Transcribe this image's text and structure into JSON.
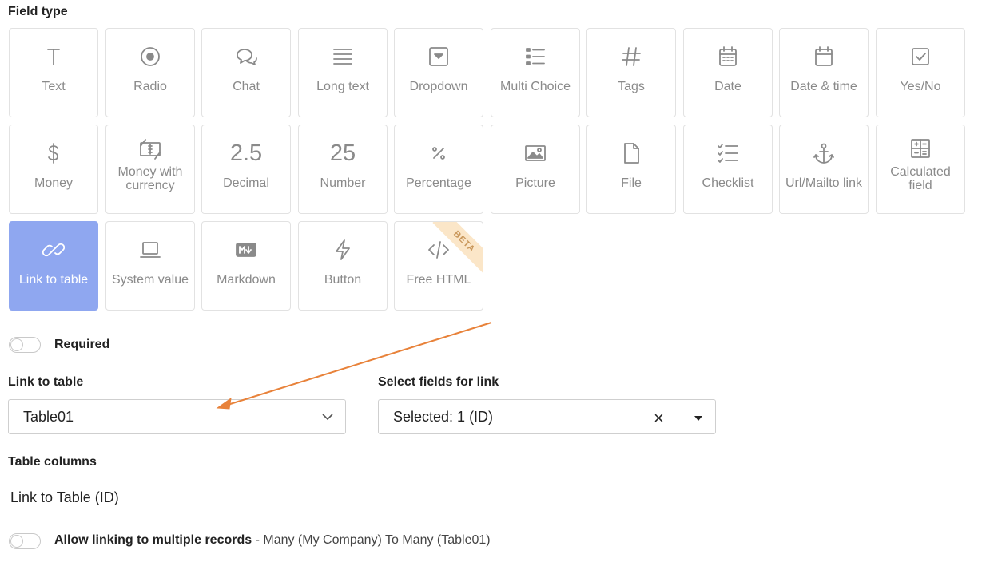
{
  "field_type": {
    "title": "Field type",
    "tiles": [
      {
        "label": "Text",
        "icon": "text-icon"
      },
      {
        "label": "Radio",
        "icon": "radio-icon"
      },
      {
        "label": "Chat",
        "icon": "chat-icon"
      },
      {
        "label": "Long text",
        "icon": "long-text-icon"
      },
      {
        "label": "Dropdown",
        "icon": "dropdown-icon"
      },
      {
        "label": "Multi Choice",
        "icon": "multi-choice-icon"
      },
      {
        "label": "Tags",
        "icon": "hash-icon"
      },
      {
        "label": "Date",
        "icon": "calendar-icon"
      },
      {
        "label": "Date & time",
        "icon": "calendar-time-icon"
      },
      {
        "label": "Yes/No",
        "icon": "checkbox-icon"
      },
      {
        "label": "Money",
        "icon": "dollar-icon"
      },
      {
        "label": "Money with currency",
        "icon": "money-currency-icon"
      },
      {
        "label": "Decimal",
        "glyph": "2.5"
      },
      {
        "label": "Number",
        "glyph": "25"
      },
      {
        "label": "Percentage",
        "icon": "percent-icon"
      },
      {
        "label": "Picture",
        "icon": "picture-icon"
      },
      {
        "label": "File",
        "icon": "file-icon"
      },
      {
        "label": "Checklist",
        "icon": "checklist-icon"
      },
      {
        "label": "Url/Mailto link",
        "icon": "anchor-icon"
      },
      {
        "label": "Calculated field",
        "icon": "calculator-icon"
      },
      {
        "label": "Link to table",
        "icon": "link-icon",
        "active": true
      },
      {
        "label": "System value",
        "icon": "laptop-icon"
      },
      {
        "label": "Markdown",
        "icon": "markdown-icon"
      },
      {
        "label": "Button",
        "icon": "lightning-icon"
      },
      {
        "label": "Free HTML",
        "icon": "code-icon",
        "badge": "BETA"
      }
    ]
  },
  "required": {
    "label": "Required"
  },
  "link_to_table": {
    "label": "Link to table",
    "value": "Table01"
  },
  "select_fields": {
    "label": "Select fields for link",
    "value": "Selected: 1 (ID)",
    "clear": "×"
  },
  "table_columns": {
    "label": "Table columns",
    "value": "Link to Table (ID)"
  },
  "allow_multiple": {
    "label": "Allow linking to multiple records",
    "note": " - Many (My Company) To Many (Table01)"
  },
  "colors": {
    "active_tile": "#8fa7f0",
    "arrow": "#e8823a",
    "beta_badge": "#fbe6c8"
  }
}
